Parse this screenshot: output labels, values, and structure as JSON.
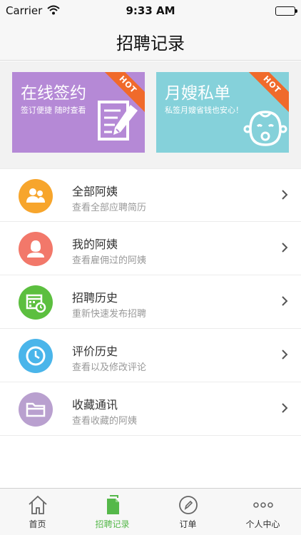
{
  "status_bar": {
    "carrier": "Carrier",
    "time": "9:33 AM"
  },
  "nav": {
    "title": "招聘记录"
  },
  "banners": [
    {
      "title": "在线签约",
      "subtitle": "签订便捷 随时查看",
      "badge": "HOT",
      "color": "#b589d6"
    },
    {
      "title": "月嫂私单",
      "subtitle": "私签月嫂省钱也安心！",
      "badge": "HOT",
      "color": "#85d1da"
    }
  ],
  "menu": [
    {
      "title": "全部阿姨",
      "subtitle": "查看全部应聘简历",
      "icon": "users-icon",
      "color": "#f7a52c"
    },
    {
      "title": "我的阿姨",
      "subtitle": "查看雇佣过的阿姨",
      "icon": "person-icon",
      "color": "#f2786a"
    },
    {
      "title": "招聘历史",
      "subtitle": "重新快速发布招聘",
      "icon": "calendar-icon",
      "color": "#5cbf3f"
    },
    {
      "title": "评价历史",
      "subtitle": "查看以及修改评论",
      "icon": "clock-icon",
      "color": "#4ab5ea"
    },
    {
      "title": "收藏通讯",
      "subtitle": "查看收藏的阿姨",
      "icon": "folder-icon",
      "color": "#b9a0cf"
    }
  ],
  "tabs": [
    {
      "label": "首页",
      "icon": "home-icon",
      "active": false
    },
    {
      "label": "招聘记录",
      "icon": "document-icon",
      "active": true
    },
    {
      "label": "订单",
      "icon": "pen-circle-icon",
      "active": false
    },
    {
      "label": "个人中心",
      "icon": "more-dots-icon",
      "active": false
    }
  ],
  "colors": {
    "active_tab": "#55b84a",
    "hot_badge": "#f06a2b"
  }
}
